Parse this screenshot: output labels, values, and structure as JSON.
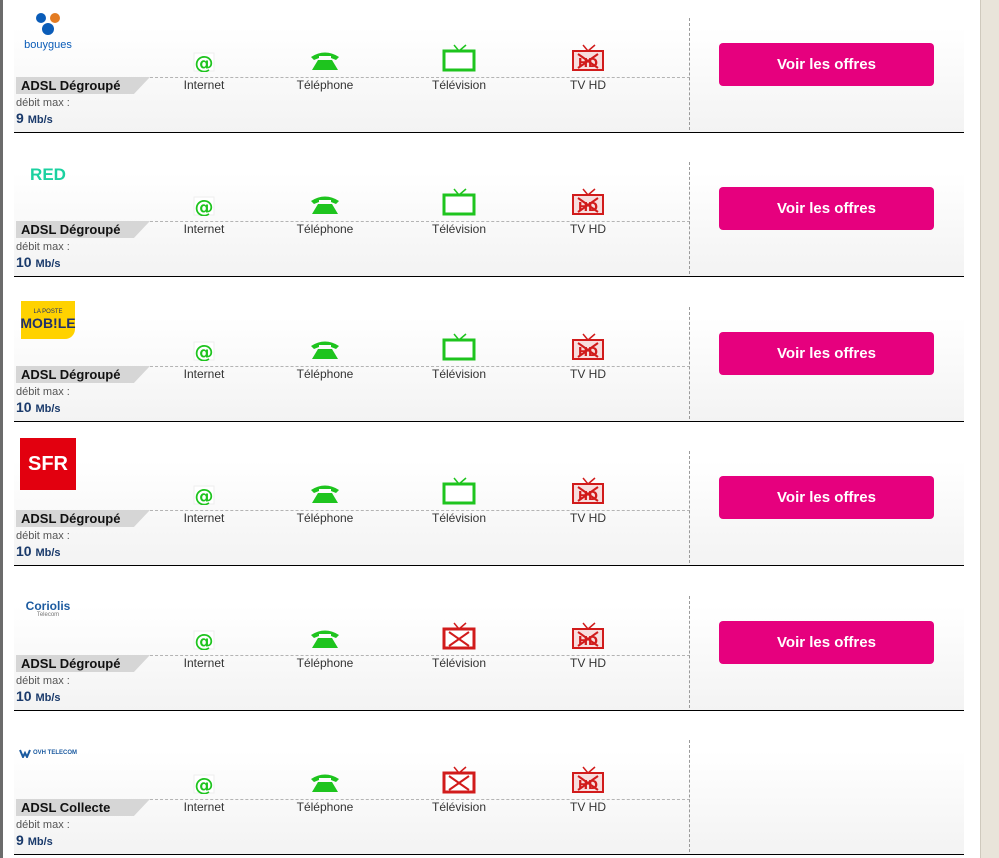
{
  "service_labels": {
    "internet": "Internet",
    "telephone": "Téléphone",
    "television": "Télévision",
    "tvhd": "TV HD"
  },
  "offer_button_label": "Voir les offres",
  "debit_label": "débit max :",
  "colors": {
    "available": "#1ec41e",
    "unavailable": "#d11b1b",
    "button": "#e6007e"
  },
  "offers": [
    {
      "provider": "Bouygues Telecom",
      "logo_text": "bouygues",
      "technology": "ADSL Dégroupé",
      "debit_value": "9",
      "debit_unit": "Mb/s",
      "internet": "available",
      "telephone": "available",
      "television": "available",
      "tvhd": "unavailable",
      "has_button": true
    },
    {
      "provider": "RED by SFR",
      "logo_text": "RED",
      "technology": "ADSL Dégroupé",
      "debit_value": "10",
      "debit_unit": "Mb/s",
      "internet": "available",
      "telephone": "available",
      "television": "available",
      "tvhd": "unavailable",
      "has_button": true
    },
    {
      "provider": "La Poste Mobile",
      "logo_text": "MOB!LE",
      "logo_sub": "LA POSTE",
      "technology": "ADSL Dégroupé",
      "debit_value": "10",
      "debit_unit": "Mb/s",
      "internet": "available",
      "telephone": "available",
      "television": "available",
      "tvhd": "unavailable",
      "has_button": true
    },
    {
      "provider": "SFR",
      "logo_text": "SFR",
      "technology": "ADSL Dégroupé",
      "debit_value": "10",
      "debit_unit": "Mb/s",
      "internet": "available",
      "telephone": "available",
      "television": "available",
      "tvhd": "unavailable",
      "has_button": true
    },
    {
      "provider": "Coriolis Telecom",
      "logo_text": "Coriolis",
      "logo_sub": "Telecom",
      "technology": "ADSL Dégroupé",
      "debit_value": "10",
      "debit_unit": "Mb/s",
      "internet": "available",
      "telephone": "available",
      "television": "unavailable",
      "tvhd": "unavailable",
      "has_button": true
    },
    {
      "provider": "OVH Telecom",
      "logo_text": "OVH TELECOM",
      "technology": "ADSL Collecte",
      "debit_value": "9",
      "debit_unit": "Mb/s",
      "internet": "available",
      "telephone": "available",
      "television": "unavailable",
      "tvhd": "unavailable",
      "has_button": false
    }
  ]
}
